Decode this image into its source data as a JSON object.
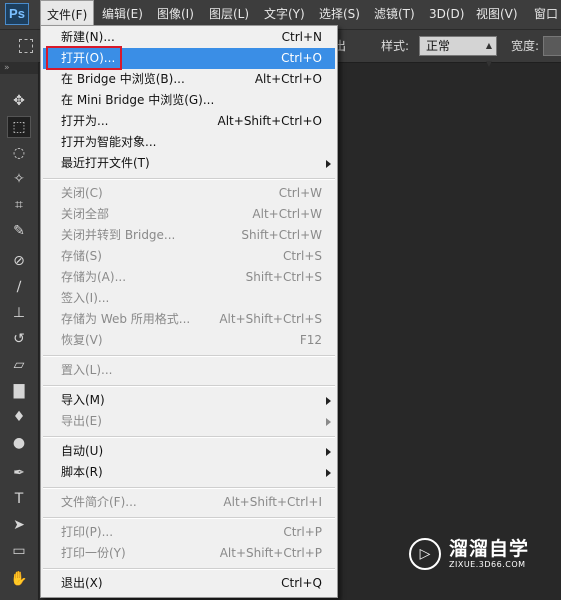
{
  "app": {
    "logo": "Ps"
  },
  "menubar": {
    "items": [
      "文件(F)",
      "编辑(E)",
      "图像(I)",
      "图层(L)",
      "文字(Y)",
      "选择(S)",
      "滤镜(T)",
      "3D(D)",
      "视图(V)",
      "窗口"
    ],
    "active_index": 0
  },
  "options": {
    "partial_label": "出",
    "style_label": "样式:",
    "style_value": "正常",
    "width_label": "宽度:"
  },
  "toolbar": {
    "header": "»",
    "tools": [
      {
        "name": "move-tool-icon",
        "glyph": "✥"
      },
      {
        "name": "marquee-tool-icon",
        "glyph": "⬚"
      },
      {
        "name": "lasso-tool-icon",
        "glyph": "◌"
      },
      {
        "name": "magic-wand-tool-icon",
        "glyph": "✧"
      },
      {
        "name": "crop-tool-icon",
        "glyph": "⌗"
      },
      {
        "name": "eyedropper-tool-icon",
        "glyph": "✎"
      },
      {
        "name": "healing-brush-tool-icon",
        "glyph": "⊘"
      },
      {
        "name": "brush-tool-icon",
        "glyph": "∕"
      },
      {
        "name": "stamp-tool-icon",
        "glyph": "⊥"
      },
      {
        "name": "history-brush-tool-icon",
        "glyph": "↺"
      },
      {
        "name": "eraser-tool-icon",
        "glyph": "▱"
      },
      {
        "name": "gradient-tool-icon",
        "glyph": "▇"
      },
      {
        "name": "blur-tool-icon",
        "glyph": "♦"
      },
      {
        "name": "dodge-tool-icon",
        "glyph": "●"
      },
      {
        "name": "pen-tool-icon",
        "glyph": "✒"
      },
      {
        "name": "type-tool-icon",
        "glyph": "T"
      },
      {
        "name": "path-selection-tool-icon",
        "glyph": "➤"
      },
      {
        "name": "shape-tool-icon",
        "glyph": "▭"
      },
      {
        "name": "hand-tool-icon",
        "glyph": "✋"
      }
    ]
  },
  "file_menu": {
    "items": [
      {
        "label": "新建(N)...",
        "shortcut": "Ctrl+N",
        "disabled": false,
        "submenu": false
      },
      {
        "label": "打开(O)...",
        "shortcut": "Ctrl+O",
        "disabled": false,
        "submenu": false,
        "highlight": true
      },
      {
        "label": "在 Bridge 中浏览(B)...",
        "shortcut": "Alt+Ctrl+O",
        "disabled": false,
        "submenu": false
      },
      {
        "label": "在 Mini Bridge 中浏览(G)...",
        "shortcut": "",
        "disabled": false,
        "submenu": false
      },
      {
        "label": "打开为...",
        "shortcut": "Alt+Shift+Ctrl+O",
        "disabled": false,
        "submenu": false
      },
      {
        "label": "打开为智能对象...",
        "shortcut": "",
        "disabled": false,
        "submenu": false
      },
      {
        "label": "最近打开文件(T)",
        "shortcut": "",
        "disabled": false,
        "submenu": true
      },
      {
        "label": "关闭(C)",
        "shortcut": "Ctrl+W",
        "disabled": true,
        "submenu": false
      },
      {
        "label": "关闭全部",
        "shortcut": "Alt+Ctrl+W",
        "disabled": true,
        "submenu": false
      },
      {
        "label": "关闭并转到 Bridge...",
        "shortcut": "Shift+Ctrl+W",
        "disabled": true,
        "submenu": false
      },
      {
        "label": "存储(S)",
        "shortcut": "Ctrl+S",
        "disabled": true,
        "submenu": false
      },
      {
        "label": "存储为(A)...",
        "shortcut": "Shift+Ctrl+S",
        "disabled": true,
        "submenu": false
      },
      {
        "label": "签入(I)...",
        "shortcut": "",
        "disabled": true,
        "submenu": false
      },
      {
        "label": "存储为 Web 所用格式...",
        "shortcut": "Alt+Shift+Ctrl+S",
        "disabled": true,
        "submenu": false
      },
      {
        "label": "恢复(V)",
        "shortcut": "F12",
        "disabled": true,
        "submenu": false
      },
      {
        "label": "置入(L)...",
        "shortcut": "",
        "disabled": true,
        "submenu": false
      },
      {
        "label": "导入(M)",
        "shortcut": "",
        "disabled": false,
        "submenu": true
      },
      {
        "label": "导出(E)",
        "shortcut": "",
        "disabled": true,
        "submenu": true
      },
      {
        "label": "自动(U)",
        "shortcut": "",
        "disabled": false,
        "submenu": true
      },
      {
        "label": "脚本(R)",
        "shortcut": "",
        "disabled": false,
        "submenu": true
      },
      {
        "label": "文件简介(F)...",
        "shortcut": "Alt+Shift+Ctrl+I",
        "disabled": true,
        "submenu": false
      },
      {
        "label": "打印(P)...",
        "shortcut": "Ctrl+P",
        "disabled": true,
        "submenu": false
      },
      {
        "label": "打印一份(Y)",
        "shortcut": "Alt+Shift+Ctrl+P",
        "disabled": true,
        "submenu": false
      },
      {
        "label": "退出(X)",
        "shortcut": "Ctrl+Q",
        "disabled": false,
        "submenu": false
      }
    ]
  },
  "watermark": {
    "title": "溜溜自学",
    "url": "ZIXUE.3D66.COM",
    "logo_glyph": "▷"
  }
}
